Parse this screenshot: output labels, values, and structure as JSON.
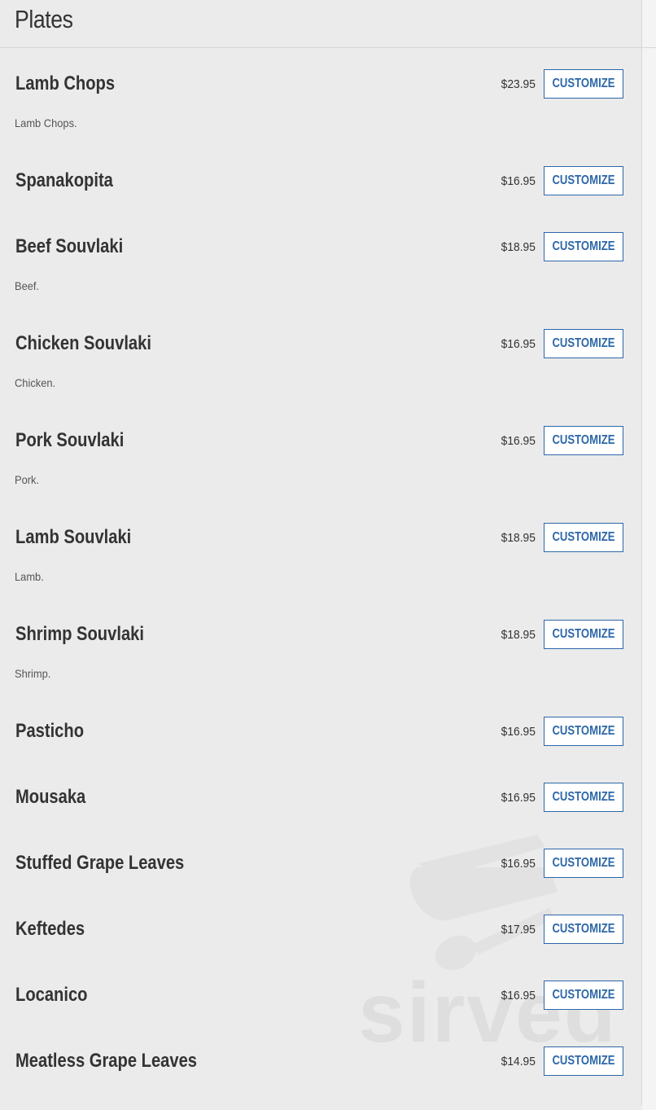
{
  "section": {
    "title": "Plates"
  },
  "button_label": "CUSTOMIZE",
  "watermark": {
    "text": "sirved"
  },
  "colors": {
    "accent": "#2d67a8",
    "background": "#ebebeb",
    "text": "#333333"
  },
  "items": [
    {
      "name": "Lamb Chops",
      "price": "$23.95",
      "desc": "Lamb Chops."
    },
    {
      "name": "Spanakopita",
      "price": "$16.95",
      "desc": ""
    },
    {
      "name": "Beef Souvlaki",
      "price": "$18.95",
      "desc": "Beef."
    },
    {
      "name": "Chicken Souvlaki",
      "price": "$16.95",
      "desc": "Chicken."
    },
    {
      "name": "Pork Souvlaki",
      "price": "$16.95",
      "desc": "Pork."
    },
    {
      "name": "Lamb Souvlaki",
      "price": "$18.95",
      "desc": "Lamb."
    },
    {
      "name": "Shrimp Souvlaki",
      "price": "$18.95",
      "desc": "Shrimp."
    },
    {
      "name": "Pasticho",
      "price": "$16.95",
      "desc": ""
    },
    {
      "name": "Mousaka",
      "price": "$16.95",
      "desc": ""
    },
    {
      "name": "Stuffed Grape Leaves",
      "price": "$16.95",
      "desc": ""
    },
    {
      "name": "Keftedes",
      "price": "$17.95",
      "desc": ""
    },
    {
      "name": "Locanico",
      "price": "$16.95",
      "desc": ""
    },
    {
      "name": "Meatless Grape Leaves",
      "price": "$14.95",
      "desc": ""
    }
  ]
}
